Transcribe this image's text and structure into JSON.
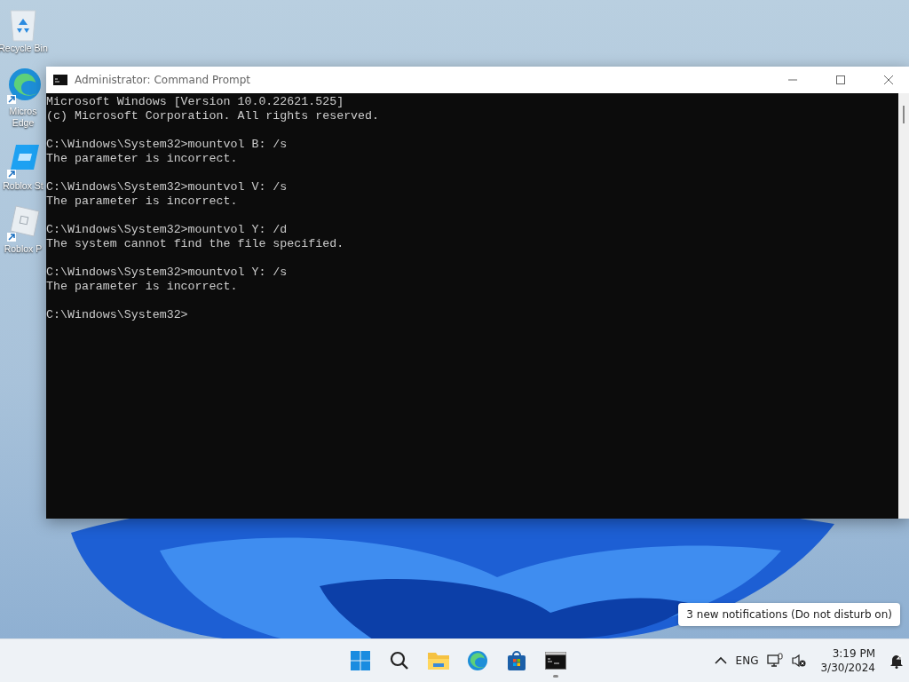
{
  "desktop_icons": [
    {
      "kind": "recycle",
      "label": "Recycle Bin"
    },
    {
      "kind": "edge",
      "label": "Micros",
      "label_2": "Edge"
    },
    {
      "kind": "studio",
      "label": "Roblox St"
    },
    {
      "kind": "player",
      "label": "Roblox P"
    }
  ],
  "window": {
    "title": "Administrator: Command Prompt",
    "console_blocks": [
      [
        "Microsoft Windows [Version 10.0.22621.525]",
        "(c) Microsoft Corporation. All rights reserved."
      ],
      [
        "C:\\Windows\\System32>mountvol B: /s",
        "The parameter is incorrect."
      ],
      [
        "C:\\Windows\\System32>mountvol V: /s",
        "The parameter is incorrect."
      ],
      [
        "C:\\Windows\\System32>mountvol Y: /d",
        "The system cannot find the file specified."
      ],
      [
        "C:\\Windows\\System32>mountvol Y: /s",
        "The parameter is incorrect."
      ],
      [
        "C:\\Windows\\System32>"
      ]
    ]
  },
  "notification": "3 new notifications (Do not disturb on)",
  "taskbar": {
    "apps": [
      {
        "kind": "start",
        "running": false
      },
      {
        "kind": "search",
        "running": false
      },
      {
        "kind": "explorer",
        "running": false
      },
      {
        "kind": "edge",
        "running": false
      },
      {
        "kind": "store",
        "running": false
      },
      {
        "kind": "terminal",
        "running": true
      }
    ],
    "language": "ENG",
    "time": "3:19 PM",
    "date": "3/30/2024"
  }
}
